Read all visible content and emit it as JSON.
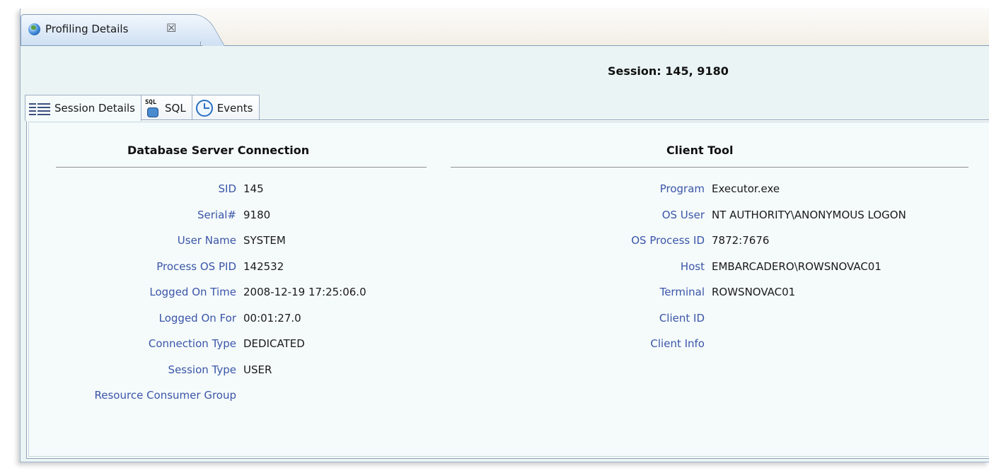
{
  "view_tab": {
    "title": "Profiling Details",
    "icon": "globe-icon",
    "close_glyph": "☒"
  },
  "session_title": "Session: 145, 9180",
  "subtabs": [
    {
      "label": "Session Details",
      "icon": "grid-icon"
    },
    {
      "label": "SQL",
      "icon": "sql-icon"
    },
    {
      "label": "Events",
      "icon": "clock-icon"
    }
  ],
  "database_server_connection": {
    "heading": "Database Server Connection",
    "fields": [
      {
        "label": "SID",
        "value": "145"
      },
      {
        "label": "Serial#",
        "value": "9180"
      },
      {
        "label": "User Name",
        "value": "SYSTEM"
      },
      {
        "label": "Process OS PID",
        "value": "142532"
      },
      {
        "label": "Logged On Time",
        "value": "2008-12-19 17:25:06.0"
      },
      {
        "label": "Logged On For",
        "value": "00:01:27.0"
      },
      {
        "label": "Connection Type",
        "value": "DEDICATED"
      },
      {
        "label": "Session Type",
        "value": "USER"
      },
      {
        "label": "Resource Consumer Group",
        "value": ""
      }
    ]
  },
  "client_tool": {
    "heading": "Client Tool",
    "fields": [
      {
        "label": "Program",
        "value": "Executor.exe"
      },
      {
        "label": "OS User",
        "value": "NT AUTHORITY\\ANONYMOUS LOGON"
      },
      {
        "label": "OS Process ID",
        "value": "7872:7676"
      },
      {
        "label": "Host",
        "value": "EMBARCADERO\\ROWSNOVAC01"
      },
      {
        "label": "Terminal",
        "value": "ROWSNOVAC01"
      },
      {
        "label": "Client ID",
        "value": ""
      },
      {
        "label": "Client Info",
        "value": ""
      }
    ]
  }
}
